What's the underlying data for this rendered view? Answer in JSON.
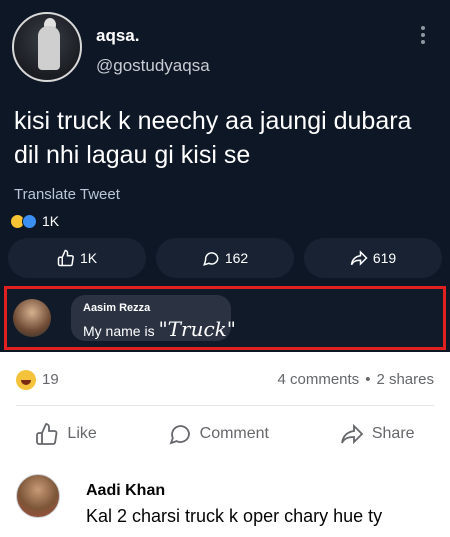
{
  "tweet": {
    "author_name": "aqsa.",
    "author_handle": "@gostudyaqsa",
    "text": "kisi truck k neechy aa jaungi dubara dil nhi lagau gi kisi se",
    "translate_label": "Translate Tweet",
    "reaction_count": "1K",
    "actions": {
      "like_count": "1K",
      "comment_count": "162",
      "share_count": "619"
    },
    "embedded_comment": {
      "author": "Aasim Rezza",
      "text_prefix": "My name is ",
      "text_emphasis": "\"Truck\""
    },
    "highlight_color": "#e0211f"
  },
  "post": {
    "reaction_count": "19",
    "comments_text": "4 comments",
    "stats_separator": "•",
    "shares_text": "2 shares",
    "actions": {
      "like_label": "Like",
      "comment_label": "Comment",
      "share_label": "Share"
    }
  },
  "comment": {
    "author": "Aadi Khan",
    "text": "Kal 2 charsi truck k oper chary hue ty"
  }
}
